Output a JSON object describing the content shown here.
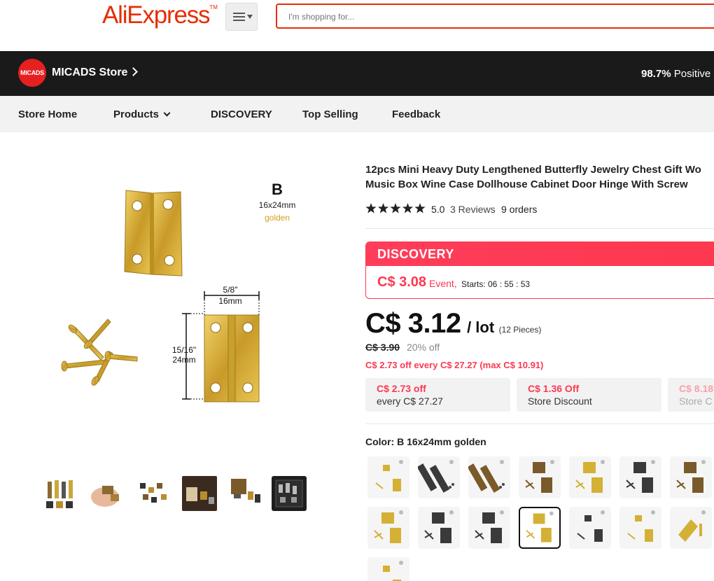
{
  "header": {
    "logo_text": "AliExpress",
    "logo_tm": "TM",
    "search_placeholder": "I'm shopping for..."
  },
  "store": {
    "logo_text": "MICADS",
    "name": "MICADS Store",
    "feedback_percent": "98.7%",
    "feedback_label": "Positive"
  },
  "nav": {
    "items": [
      "Store Home",
      "Products",
      "DISCOVERY",
      "Top Selling",
      "Feedback"
    ]
  },
  "product_image": {
    "variant_letter": "B",
    "size_label": "16x24mm",
    "color_label": "golden",
    "width_fraction": "5/8\"",
    "width_mm": "16mm",
    "height_fraction": "15/16\"",
    "height_mm": "24mm"
  },
  "product": {
    "title_line1": "12pcs Mini Heavy Duty Lengthened Butterfly Jewelry Chest Gift Wo",
    "title_line2": "Music Box Wine Case Dollhouse Cabinet Door Hinge With Screw",
    "rating": "5.0",
    "reviews": "3 Reviews",
    "orders": "9 orders",
    "stars": 5
  },
  "discovery": {
    "label": "DISCOVERY",
    "event_price": "C$ 3.08",
    "event_label": "Event,",
    "starts_text": "Starts: 06 : 55 : 53"
  },
  "price": {
    "current": "C$ 3.12",
    "unit": "/ lot",
    "pieces": "(12 Pieces)",
    "original": "C$ 3.90",
    "discount": "20% off",
    "coupon_line": "C$ 2.73 off every C$ 27.27 (max C$ 10.91)"
  },
  "coupons": [
    {
      "top": "C$ 2.73 off",
      "bottom": "every C$ 27.27"
    },
    {
      "top": "C$ 1.36 Off",
      "bottom": "Store Discount"
    },
    {
      "top": "C$ 8.18",
      "bottom": "Store C"
    }
  ],
  "color": {
    "label": "Color: B 16x24mm golden",
    "selected_index": 10,
    "swatches": [
      {
        "tone": "gold",
        "style": "small"
      },
      {
        "tone": "dark",
        "style": "long"
      },
      {
        "tone": "bronze",
        "style": "long"
      },
      {
        "tone": "bronze",
        "style": "hinge"
      },
      {
        "tone": "gold",
        "style": "hinge"
      },
      {
        "tone": "dark",
        "style": "hinge"
      },
      {
        "tone": "bronze",
        "style": "hinge"
      },
      {
        "tone": "gold",
        "style": "hinge"
      },
      {
        "tone": "dark",
        "style": "hinge"
      },
      {
        "tone": "dark",
        "style": "hinge"
      },
      {
        "tone": "gold",
        "style": "hinge"
      },
      {
        "tone": "dark",
        "style": "small"
      },
      {
        "tone": "gold",
        "style": "small"
      },
      {
        "tone": "gold",
        "style": "angle"
      },
      {
        "tone": "gold",
        "style": "small"
      }
    ]
  },
  "colors": {
    "brand": "#e62e04",
    "discovery": "#fd384f",
    "gold": "#d4b035",
    "bronze": "#7a5a2a",
    "dark": "#3a3a3a"
  }
}
